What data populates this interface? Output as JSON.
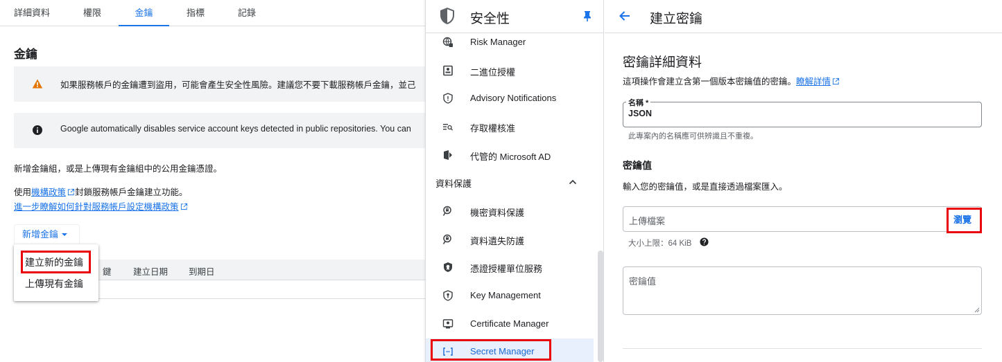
{
  "left": {
    "tabs": [
      "詳細資料",
      "權限",
      "金鑰",
      "指標",
      "記錄"
    ],
    "active_tab": "金鑰",
    "section_title": "金鑰",
    "warning_text": "如果服務帳戶的金鑰遭到盜用，可能會產生安全性風險。建議您不要下載服務帳戶金鑰，並己",
    "info_text": "Google automatically disables service account keys detected in public repositories. You can",
    "para1": "新增金鑰組，或是上傳現有金鑰組中的公用金鑰憑證。",
    "para2_prefix": "使用",
    "para2_link": "機構政策",
    "para2_suffix": "封鎖服務帳戶金鑰建立功能。",
    "para3_link": "進一步瞭解如何針對服務帳戶設定機構政策",
    "add_key_label": "新增金鑰",
    "dropdown": [
      "建立新的金鑰",
      "上傳現有金鑰"
    ],
    "table_columns": [
      "鍵",
      "建立日期",
      "到期日"
    ]
  },
  "nav": {
    "title": "安全性",
    "items_top": [
      {
        "label": "Risk Manager",
        "icon": "globe-icon"
      },
      {
        "label": "二進位授權",
        "icon": "badge-icon"
      },
      {
        "label": "Advisory Notifications",
        "icon": "shield-info-icon"
      },
      {
        "label": "存取權核准",
        "icon": "list-search-icon"
      },
      {
        "label": "代管的 Microsoft AD",
        "icon": "microsoft-ad-icon"
      }
    ],
    "group_label": "資料保護",
    "items_bottom": [
      {
        "label": "機密資料保護",
        "icon": "search-lock-icon"
      },
      {
        "label": "資料遺失防護",
        "icon": "search-lock-icon"
      },
      {
        "label": "憑證授權單位服務",
        "icon": "shield-badge-icon"
      },
      {
        "label": "Key Management",
        "icon": "shield-key-icon"
      },
      {
        "label": "Certificate Manager",
        "icon": "certificate-icon"
      },
      {
        "label": "Secret Manager",
        "icon": "secret-brackets-icon"
      }
    ]
  },
  "right": {
    "header_title": "建立密鑰",
    "details_title": "密鑰詳細資料",
    "details_desc": "這項操作會建立含第一個版本密鑰值的密鑰。",
    "learn_more": "瞭解詳情",
    "name_label": "名稱 *",
    "name_value": "JSON",
    "name_hint": "此專案內的名稱應可供辨識且不重複。",
    "secret_value_title": "密鑰值",
    "secret_value_desc": "輸入您的密鑰值，或是直接透過檔案匯入。",
    "upload_placeholder": "上傳檔案",
    "browse_label": "瀏覽",
    "size_limit": "大小上限：64 KiB",
    "value_placeholder": "密鑰值"
  },
  "colors": {
    "accent": "#1a73e8",
    "highlight": "#e8000b",
    "warning": "#e37400"
  }
}
